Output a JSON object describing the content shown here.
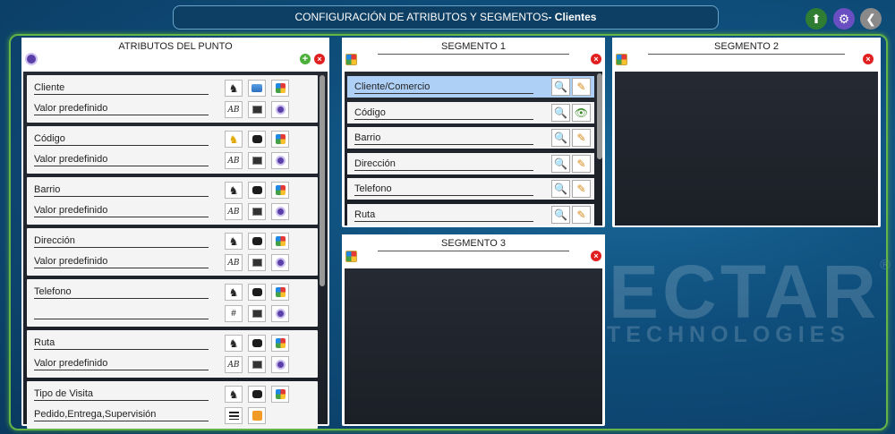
{
  "header": {
    "title_prefix": "CONFIGURACIÓN DE ATRIBUTOS Y SEGMENTOS",
    "title_entity": "- Clientes"
  },
  "top_actions": [
    {
      "name": "cloud-sync-icon",
      "color": "#4caf3a"
    },
    {
      "name": "settings-gear-icon",
      "color": "#6a4fc2"
    },
    {
      "name": "back-chevron-icon",
      "color": "#8a8a8a"
    }
  ],
  "watermark": {
    "brand": "ECTAR",
    "sub": "TECHNOLOGIES",
    "reg": "®"
  },
  "attributes_panel": {
    "title": "ATRIBUTOS DEL PUNTO",
    "items": [
      {
        "name": "Cliente",
        "default": "Valor predefinido",
        "type_icon": "AB",
        "icons": [
          "figure-icon",
          "chat-icon",
          "palette-icon"
        ]
      },
      {
        "name": "Código",
        "default": "Valor predefinido",
        "type_icon": "AB",
        "icons": [
          "figure-icon",
          "chat-icon",
          "palette-icon"
        ]
      },
      {
        "name": "Barrio",
        "default": "Valor predefinido",
        "type_icon": "AB",
        "icons": [
          "figure-icon",
          "chat-icon",
          "palette-icon"
        ]
      },
      {
        "name": "Dirección",
        "default": "Valor predefinido",
        "type_icon": "AB",
        "icons": [
          "figure-icon",
          "chat-icon",
          "palette-icon"
        ]
      },
      {
        "name": "Telefono",
        "default": "",
        "type_icon": "#",
        "icons": [
          "figure-icon",
          "chat-icon",
          "palette-icon"
        ]
      },
      {
        "name": "Ruta",
        "default": "Valor predefinido",
        "type_icon": "AB",
        "icons": [
          "figure-icon",
          "chat-icon",
          "palette-icon"
        ]
      },
      {
        "name": "Tipo de Visita",
        "default": "Pedido,Entrega,Supervisión",
        "type_icon": "list",
        "icons": [
          "figure-icon",
          "chat-icon",
          "palette-icon"
        ]
      }
    ]
  },
  "segment1": {
    "title": "SEGMENTO 1",
    "rows": [
      {
        "label": "Cliente/Comercio",
        "selected": true,
        "action": "pencil"
      },
      {
        "label": "Código",
        "selected": false,
        "action": "eye"
      },
      {
        "label": "Barrio",
        "selected": false,
        "action": "pencil"
      },
      {
        "label": "Dirección",
        "selected": false,
        "action": "pencil"
      },
      {
        "label": "Telefono",
        "selected": false,
        "action": "pencil"
      },
      {
        "label": "Ruta",
        "selected": false,
        "action": "pencil"
      }
    ]
  },
  "segment2": {
    "title": "SEGMENTO 2"
  },
  "segment3": {
    "title": "SEGMENTO 3"
  },
  "glyphs": {
    "plus": "+",
    "close": "×",
    "mag": "🔍",
    "pencil": "✎",
    "eye": "👁",
    "figure": "♞",
    "gear": "⚙",
    "back": "❮",
    "hash": "#",
    "cloud": "⬆"
  }
}
